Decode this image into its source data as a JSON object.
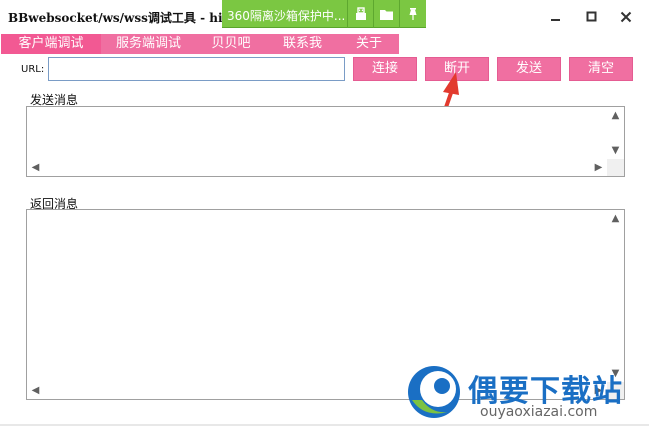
{
  "window": {
    "title": "BBwebsocket/ws/wss调试工具 - hi"
  },
  "sandbox_bar": {
    "text": "360隔离沙箱保护中...",
    "icons": [
      "usb-icon",
      "folder-icon",
      "pin-icon"
    ],
    "color": "#7bc742"
  },
  "window_controls": {
    "minimize": "minimize-icon",
    "maximize": "maximize-icon",
    "close": "close-icon"
  },
  "tabs": [
    {
      "label": "客户端调试",
      "active": true
    },
    {
      "label": "服务端调试",
      "active": false
    },
    {
      "label": "贝贝吧",
      "active": false
    },
    {
      "label": "联系我",
      "active": false
    },
    {
      "label": "关于",
      "active": false
    }
  ],
  "url": {
    "label": "URL:",
    "value": ""
  },
  "buttons": {
    "connect": "连接",
    "disconnect": "断开",
    "send": "发送",
    "clear": "清空"
  },
  "send_box": {
    "label": "发送消息",
    "value": ""
  },
  "receive_box": {
    "label": "返回消息",
    "value": ""
  },
  "annotation": {
    "arrow_color": "#e23a2e"
  },
  "watermark": {
    "brand": "偶要下载站",
    "url": "ouyaoxiazai.com"
  },
  "colors": {
    "accent": "#f06fa1",
    "accent_active": "#f25993"
  }
}
